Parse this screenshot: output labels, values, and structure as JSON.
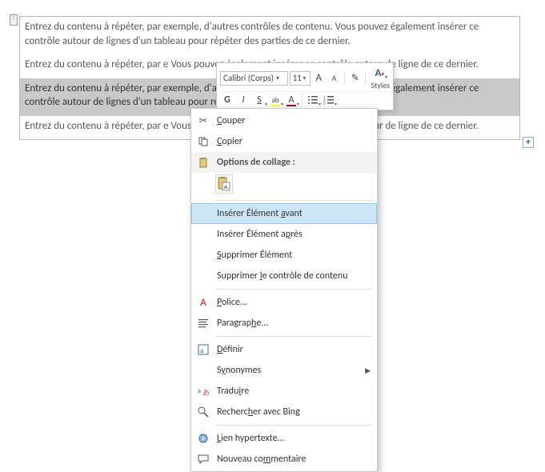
{
  "placeholder_text": "Entrez du contenu à répéter, par exemple, d'autres contrôles de contenu. Vous pouvez également insérer ce contrôle autour de lignes d'un tableau pour répéter des parties de ce dernier.",
  "placeholder_text_cut": "Entrez du contenu à répéter, par e                                                                                   Vous pouvez également insérer ce contrôle autour de ligne                                                                     de ce dernier.",
  "add_symbol": "+",
  "mini_toolbar": {
    "font_name": "Calibri (Corps)",
    "font_size": "11",
    "styles_label": "Styles",
    "grow_font": "A",
    "shrink_font": "A",
    "bold": "G",
    "italic": "I",
    "underline": "S",
    "highlight": "ab",
    "font_color": "A",
    "brush_icon": "✎"
  },
  "context_menu": {
    "cut": "ouper",
    "copy": "opier",
    "paste_options": "Options de collage :",
    "insert_before_prefix": "Insérer Élément ",
    "insert_before_u": "a",
    "insert_before_suffix": "vant",
    "insert_after_prefix": "Insérer Élément a",
    "insert_after_u": "p",
    "insert_after_suffix": "rès",
    "delete_item_u": "S",
    "delete_item_suffix": "upprimer Élément",
    "delete_control_prefix": "Supprimer ",
    "delete_control_u": "l",
    "delete_control_suffix": "e contrôle de contenu",
    "font_u": "P",
    "font_suffix": "olice...",
    "paragraph_prefix": "Paragrap",
    "paragraph_u": "h",
    "paragraph_suffix": "e...",
    "define_u": "D",
    "define_suffix": "éfinir",
    "synonyms_prefix": "S",
    "synonyms_u": "y",
    "synonyms_suffix": "nonymes",
    "translate_prefix": "Tradu",
    "translate_u": "i",
    "translate_suffix": "re",
    "search_prefix": "Recherc",
    "search_u": "h",
    "search_suffix": "er avec Bing",
    "hyperlink_u": "L",
    "hyperlink_suffix": "ien hypertexte...",
    "comment_prefix": "Nouveau co",
    "comment_u": "m",
    "comment_suffix": "mentaire"
  },
  "mnemonic_single": {
    "cut": "C",
    "copy": "C"
  }
}
